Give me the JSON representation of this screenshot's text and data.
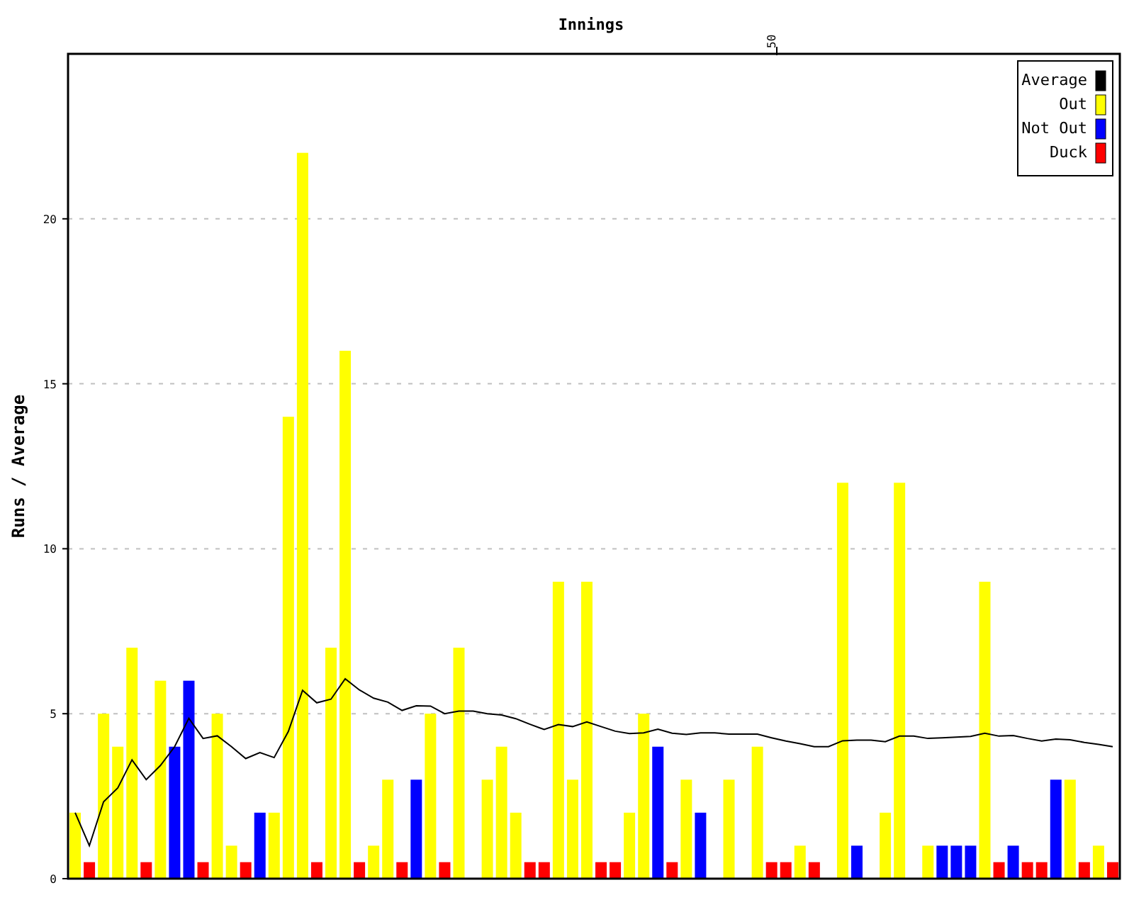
{
  "chart": {
    "chart_data": {
      "type": "bar",
      "title": "Innings",
      "ylabel": "Runs / Average",
      "grid": true,
      "legend": true,
      "ylim": [
        0,
        25
      ],
      "yticks": [
        {
          "value": 0,
          "label": "0"
        },
        {
          "value": 5,
          "label": "5"
        },
        {
          "value": 10,
          "label": "10"
        },
        {
          "value": 15,
          "label": "15"
        },
        {
          "value": 20,
          "label": "20"
        }
      ],
      "annotations": [
        "50"
      ],
      "series": [
        {
          "name": "Average",
          "type": "line",
          "color": "#000000",
          "values": [
            2,
            1,
            2.33,
            2.75,
            3.6,
            3,
            3.43,
            4,
            4.86,
            4.25,
            4.33,
            4,
            3.64,
            3.82,
            3.67,
            4.46,
            5.71,
            5.33,
            5.44,
            6.06,
            5.72,
            5.47,
            5.35,
            5.1,
            5.24,
            5.23,
            5,
            5.08,
            5.08,
            5,
            4.96,
            4.85,
            4.68,
            4.52,
            4.67,
            4.61,
            4.75,
            4.61,
            4.47,
            4.4,
            4.42,
            4.53,
            4.41,
            4.37,
            4.42,
            4.42,
            4.38,
            4.38,
            4.38,
            4.27,
            4.17,
            4.09,
            4,
            4,
            4.18,
            4.2,
            4.2,
            4.15,
            4.32,
            4.32,
            4.25,
            4.27,
            4.29,
            4.31,
            4.41,
            4.32,
            4.34,
            4.25,
            4.17,
            4.23,
            4.21,
            4.13,
            4.07,
            4
          ]
        },
        {
          "name": "Out",
          "type": "bar",
          "color": "#ffff00",
          "values": [
            2,
            null,
            5,
            4,
            7,
            null,
            6,
            null,
            null,
            null,
            5,
            1,
            null,
            null,
            2,
            14,
            22,
            null,
            7,
            16,
            null,
            1,
            3,
            null,
            null,
            5,
            null,
            7,
            null,
            3,
            4,
            2,
            null,
            null,
            9,
            3,
            9,
            null,
            null,
            2,
            5,
            null,
            null,
            3,
            null,
            null,
            3,
            null,
            4,
            null,
            null,
            1,
            null,
            null,
            12,
            null,
            null,
            2,
            12,
            null,
            1,
            null,
            null,
            null,
            9,
            null,
            null,
            null,
            null,
            null,
            3,
            null,
            1,
            null
          ]
        },
        {
          "name": "Not Out",
          "type": "bar",
          "color": "#0000ff",
          "values": [
            null,
            null,
            null,
            null,
            null,
            null,
            null,
            4,
            6,
            null,
            null,
            null,
            null,
            2,
            null,
            null,
            null,
            null,
            null,
            null,
            null,
            null,
            null,
            null,
            3,
            null,
            null,
            null,
            null,
            null,
            null,
            null,
            null,
            null,
            null,
            null,
            null,
            null,
            null,
            null,
            null,
            4,
            null,
            null,
            2,
            null,
            null,
            null,
            null,
            null,
            null,
            null,
            null,
            null,
            null,
            1,
            null,
            null,
            null,
            null,
            null,
            1,
            1,
            1,
            null,
            null,
            1,
            null,
            null,
            3,
            null,
            null,
            null,
            null
          ]
        },
        {
          "name": "Duck",
          "type": "bar",
          "color": "#ff0000",
          "values": [
            null,
            0.5,
            null,
            null,
            null,
            0.5,
            null,
            null,
            null,
            0.5,
            null,
            null,
            0.5,
            null,
            null,
            null,
            null,
            0.5,
            null,
            null,
            0.5,
            null,
            null,
            0.5,
            null,
            null,
            0.5,
            null,
            null,
            null,
            null,
            null,
            0.5,
            0.5,
            null,
            null,
            null,
            0.5,
            0.5,
            null,
            null,
            null,
            0.5,
            null,
            null,
            null,
            null,
            null,
            null,
            0.5,
            0.5,
            null,
            0.5,
            null,
            null,
            null,
            null,
            null,
            null,
            null,
            null,
            null,
            null,
            null,
            null,
            0.5,
            null,
            0.5,
            0.5,
            null,
            null,
            0.5,
            null,
            0.5
          ]
        }
      ]
    }
  }
}
